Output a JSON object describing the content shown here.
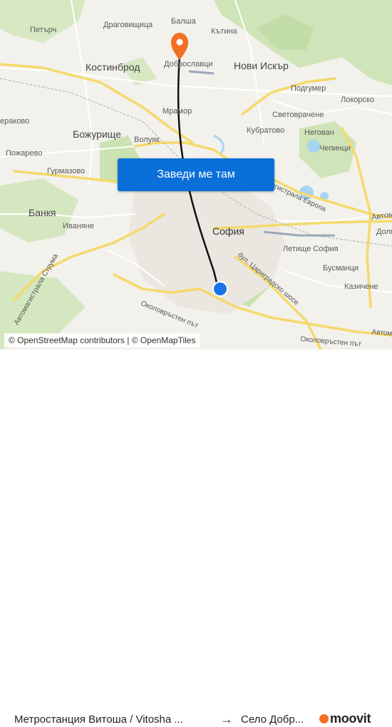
{
  "map": {
    "places": [
      {
        "name": "Балша",
        "id": "balsha"
      },
      {
        "name": "Петърч",
        "id": "petarch"
      },
      {
        "name": "Драговищица",
        "id": "dragovishtitsa"
      },
      {
        "name": "Кътина",
        "id": "katina"
      },
      {
        "name": "Костинброд",
        "id": "kostinbrod"
      },
      {
        "name": "Доброславци",
        "id": "dobroslavtsi"
      },
      {
        "name": "Нови Искър",
        "id": "novi-iskar"
      },
      {
        "name": "Подгумер",
        "id": "podgumer"
      },
      {
        "name": "Локорско",
        "id": "lokorsko"
      },
      {
        "name": "ераково",
        "id": "erakovo"
      },
      {
        "name": "Мрамор",
        "id": "mramor"
      },
      {
        "name": "Световрачене",
        "id": "svetovrachene"
      },
      {
        "name": "Божурище",
        "id": "bozhurishte"
      },
      {
        "name": "Кубратово",
        "id": "kubratovo"
      },
      {
        "name": "Негован",
        "id": "negovan"
      },
      {
        "name": "Волуяк",
        "id": "voluyak"
      },
      {
        "name": "Пожарево",
        "id": "pozharevo"
      },
      {
        "name": "Чепинци",
        "id": "chepintsi"
      },
      {
        "name": "Гурмазово",
        "id": "gurmazovo"
      },
      {
        "name": "Банкя",
        "id": "bankya"
      },
      {
        "name": "Иваняне",
        "id": "ivanyane"
      },
      {
        "name": "София",
        "id": "sofia"
      },
      {
        "name": "Летище София",
        "id": "airport"
      },
      {
        "name": "Бусманци",
        "id": "busmantsi"
      },
      {
        "name": "Казичене",
        "id": "kazichene"
      },
      {
        "name": "Долн",
        "id": "doln"
      },
      {
        "name": "Автом",
        "id": "avtom"
      }
    ],
    "roads": [
      {
        "name": "Автомагистрала Европа",
        "visible_text": "агистрала Европа"
      },
      {
        "name": "бул. Цариградско шосе",
        "visible_text": "бул. Цариградско шосе"
      },
      {
        "name": "Автомагистрала Струма",
        "visible_text": "Автомагистрала Струма"
      },
      {
        "name": "Околовръстен път (west)",
        "visible_text": "Околовръстен път"
      },
      {
        "name": "Околовръстен път (east)",
        "visible_text": "Околовръстен път"
      },
      {
        "name": "Автом (east)",
        "visible_text": "Автом"
      }
    ],
    "attribution": "© OpenStreetMap contributors | © OpenMapTiles",
    "cta_label": "Заведи ме там",
    "colors": {
      "route": "#111111",
      "destination_pin": "#f37021",
      "origin_dot": "#1a73e8",
      "cta": "#0a6fd8",
      "highway": "#f7e58a",
      "park": "#c9e3b0",
      "water": "#a9d3f2"
    }
  },
  "footer": {
    "origin": "Метростанция Витоша / Vitosha ...",
    "arrow": "→",
    "destination": "Село Добр...",
    "brand": "moovit"
  }
}
